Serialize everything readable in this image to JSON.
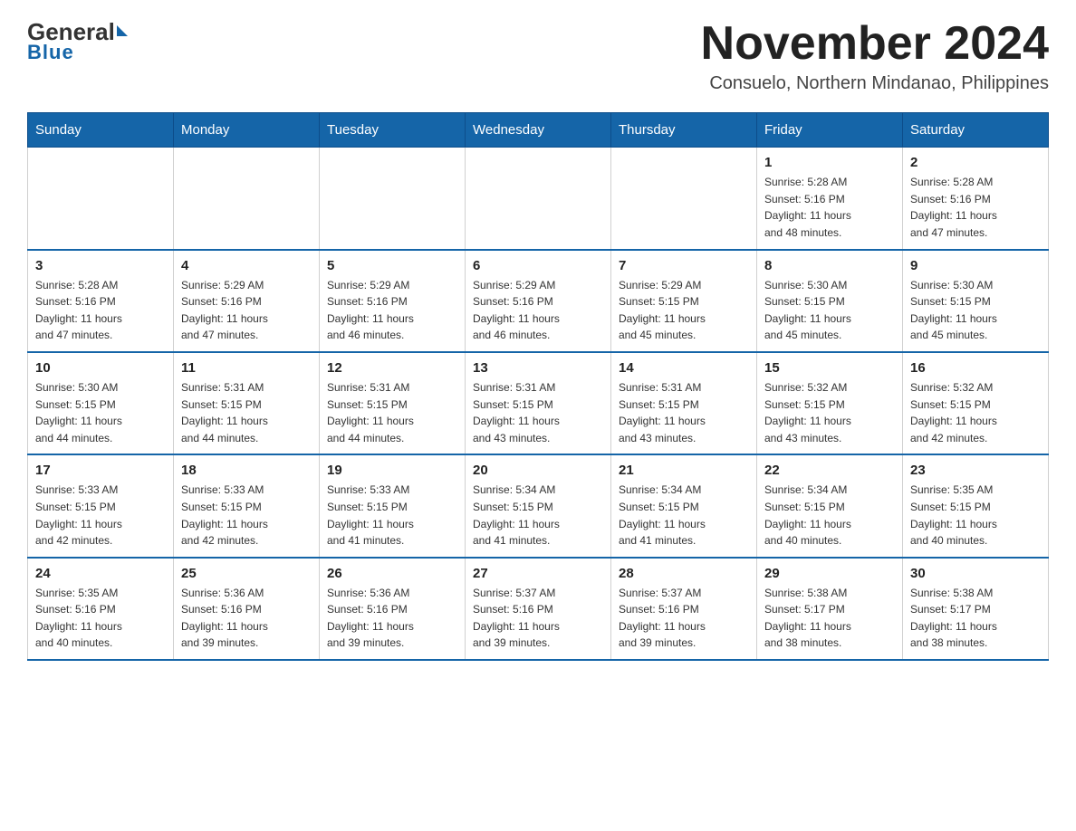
{
  "logo": {
    "general": "General",
    "triangle": "",
    "blue": "Blue"
  },
  "title": "November 2024",
  "location": "Consuelo, Northern Mindanao, Philippines",
  "weekdays": [
    "Sunday",
    "Monday",
    "Tuesday",
    "Wednesday",
    "Thursday",
    "Friday",
    "Saturday"
  ],
  "weeks": [
    [
      {
        "day": "",
        "detail": ""
      },
      {
        "day": "",
        "detail": ""
      },
      {
        "day": "",
        "detail": ""
      },
      {
        "day": "",
        "detail": ""
      },
      {
        "day": "",
        "detail": ""
      },
      {
        "day": "1",
        "detail": "Sunrise: 5:28 AM\nSunset: 5:16 PM\nDaylight: 11 hours\nand 48 minutes."
      },
      {
        "day": "2",
        "detail": "Sunrise: 5:28 AM\nSunset: 5:16 PM\nDaylight: 11 hours\nand 47 minutes."
      }
    ],
    [
      {
        "day": "3",
        "detail": "Sunrise: 5:28 AM\nSunset: 5:16 PM\nDaylight: 11 hours\nand 47 minutes."
      },
      {
        "day": "4",
        "detail": "Sunrise: 5:29 AM\nSunset: 5:16 PM\nDaylight: 11 hours\nand 47 minutes."
      },
      {
        "day": "5",
        "detail": "Sunrise: 5:29 AM\nSunset: 5:16 PM\nDaylight: 11 hours\nand 46 minutes."
      },
      {
        "day": "6",
        "detail": "Sunrise: 5:29 AM\nSunset: 5:16 PM\nDaylight: 11 hours\nand 46 minutes."
      },
      {
        "day": "7",
        "detail": "Sunrise: 5:29 AM\nSunset: 5:15 PM\nDaylight: 11 hours\nand 45 minutes."
      },
      {
        "day": "8",
        "detail": "Sunrise: 5:30 AM\nSunset: 5:15 PM\nDaylight: 11 hours\nand 45 minutes."
      },
      {
        "day": "9",
        "detail": "Sunrise: 5:30 AM\nSunset: 5:15 PM\nDaylight: 11 hours\nand 45 minutes."
      }
    ],
    [
      {
        "day": "10",
        "detail": "Sunrise: 5:30 AM\nSunset: 5:15 PM\nDaylight: 11 hours\nand 44 minutes."
      },
      {
        "day": "11",
        "detail": "Sunrise: 5:31 AM\nSunset: 5:15 PM\nDaylight: 11 hours\nand 44 minutes."
      },
      {
        "day": "12",
        "detail": "Sunrise: 5:31 AM\nSunset: 5:15 PM\nDaylight: 11 hours\nand 44 minutes."
      },
      {
        "day": "13",
        "detail": "Sunrise: 5:31 AM\nSunset: 5:15 PM\nDaylight: 11 hours\nand 43 minutes."
      },
      {
        "day": "14",
        "detail": "Sunrise: 5:31 AM\nSunset: 5:15 PM\nDaylight: 11 hours\nand 43 minutes."
      },
      {
        "day": "15",
        "detail": "Sunrise: 5:32 AM\nSunset: 5:15 PM\nDaylight: 11 hours\nand 43 minutes."
      },
      {
        "day": "16",
        "detail": "Sunrise: 5:32 AM\nSunset: 5:15 PM\nDaylight: 11 hours\nand 42 minutes."
      }
    ],
    [
      {
        "day": "17",
        "detail": "Sunrise: 5:33 AM\nSunset: 5:15 PM\nDaylight: 11 hours\nand 42 minutes."
      },
      {
        "day": "18",
        "detail": "Sunrise: 5:33 AM\nSunset: 5:15 PM\nDaylight: 11 hours\nand 42 minutes."
      },
      {
        "day": "19",
        "detail": "Sunrise: 5:33 AM\nSunset: 5:15 PM\nDaylight: 11 hours\nand 41 minutes."
      },
      {
        "day": "20",
        "detail": "Sunrise: 5:34 AM\nSunset: 5:15 PM\nDaylight: 11 hours\nand 41 minutes."
      },
      {
        "day": "21",
        "detail": "Sunrise: 5:34 AM\nSunset: 5:15 PM\nDaylight: 11 hours\nand 41 minutes."
      },
      {
        "day": "22",
        "detail": "Sunrise: 5:34 AM\nSunset: 5:15 PM\nDaylight: 11 hours\nand 40 minutes."
      },
      {
        "day": "23",
        "detail": "Sunrise: 5:35 AM\nSunset: 5:15 PM\nDaylight: 11 hours\nand 40 minutes."
      }
    ],
    [
      {
        "day": "24",
        "detail": "Sunrise: 5:35 AM\nSunset: 5:16 PM\nDaylight: 11 hours\nand 40 minutes."
      },
      {
        "day": "25",
        "detail": "Sunrise: 5:36 AM\nSunset: 5:16 PM\nDaylight: 11 hours\nand 39 minutes."
      },
      {
        "day": "26",
        "detail": "Sunrise: 5:36 AM\nSunset: 5:16 PM\nDaylight: 11 hours\nand 39 minutes."
      },
      {
        "day": "27",
        "detail": "Sunrise: 5:37 AM\nSunset: 5:16 PM\nDaylight: 11 hours\nand 39 minutes."
      },
      {
        "day": "28",
        "detail": "Sunrise: 5:37 AM\nSunset: 5:16 PM\nDaylight: 11 hours\nand 39 minutes."
      },
      {
        "day": "29",
        "detail": "Sunrise: 5:38 AM\nSunset: 5:17 PM\nDaylight: 11 hours\nand 38 minutes."
      },
      {
        "day": "30",
        "detail": "Sunrise: 5:38 AM\nSunset: 5:17 PM\nDaylight: 11 hours\nand 38 minutes."
      }
    ]
  ]
}
